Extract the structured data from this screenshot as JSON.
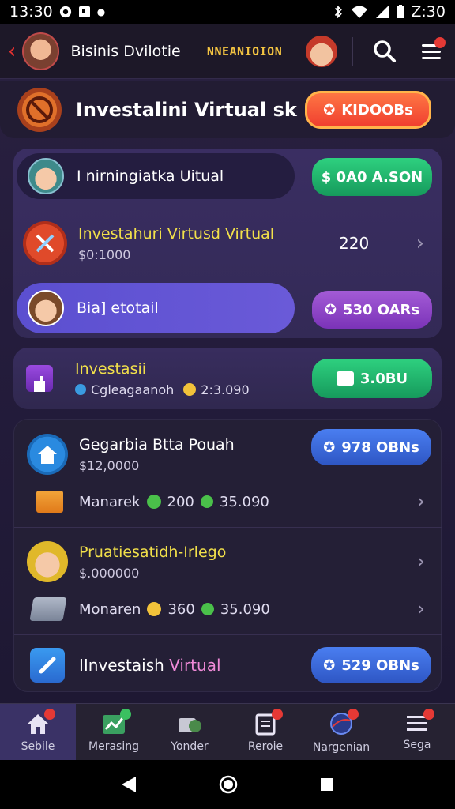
{
  "status_bar": {
    "time_left": "13:30",
    "time_right": "Z:30"
  },
  "app_bar": {
    "title": "Bisinis Dvilotie",
    "brand": "NNEANIOION"
  },
  "hero": {
    "title": "Investalini Virtual sk",
    "button": "KIDOOBs"
  },
  "card1": {
    "row1": {
      "label": "I nirningiatka Uitual",
      "button": "$ 0A0 A.SON"
    },
    "row2": {
      "title": "Investahuri Virtusd Virtual",
      "sub": "$0:1000",
      "value": "220"
    },
    "row3": {
      "label": "Bia] etotail",
      "button": "530 OARs"
    }
  },
  "card2": {
    "title": "Investasii",
    "sub_left": "Cgleagaanoh",
    "sub_right": "2:3.090",
    "button": "3.0BU"
  },
  "card3": {
    "item1": {
      "title": "Gegarbia Btta Pouah",
      "sub": "$12,0000",
      "button": "978 OBNs"
    },
    "item2": {
      "label": "Manarek",
      "value1": "200",
      "value2": "35.090"
    },
    "item3": {
      "title": "Pruatiesatidh-Irlego",
      "sub": "$.000000"
    },
    "item4": {
      "label": "Monaren",
      "value1": "360",
      "value2": "35.090"
    },
    "item5": {
      "title_a": "IInvestaish",
      "title_b": "Virtual",
      "button": "529 OBNs"
    }
  },
  "tabs": [
    {
      "label": "Sebile"
    },
    {
      "label": "Merasing"
    },
    {
      "label": "Yonder"
    },
    {
      "label": "Reroie"
    },
    {
      "label": "Nargenian"
    },
    {
      "label": "Sega"
    }
  ],
  "colors": {
    "accent_yellow": "#f2e04a",
    "accent_green": "#2ed07f",
    "accent_purple": "#a35bd6",
    "accent_blue": "#4a7ef0",
    "accent_orange": "#ff7a45"
  }
}
